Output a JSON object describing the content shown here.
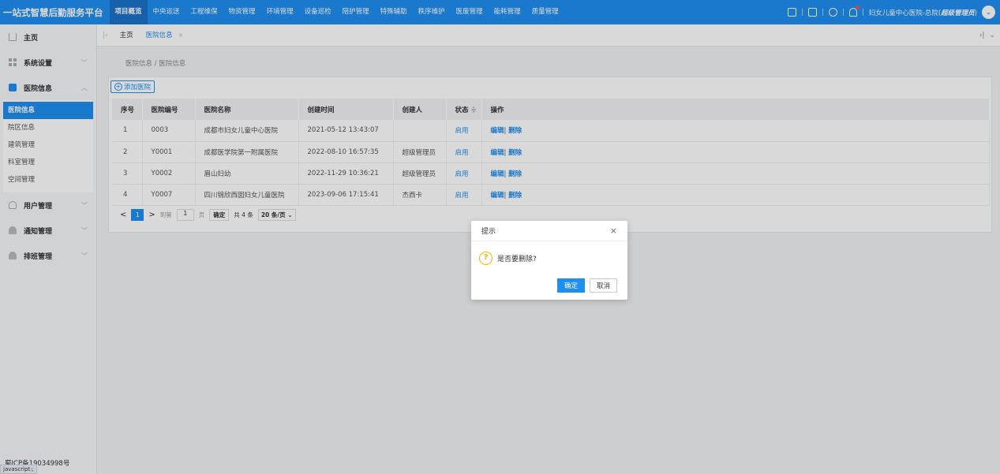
{
  "header": {
    "brand": "一站式智慧后勤服务平台",
    "nav": [
      "项目概览",
      "中央运送",
      "工程维保",
      "物资管理",
      "环境管理",
      "设备巡检",
      "陪护管理",
      "特殊辅助",
      "秩序维护",
      "医废管理",
      "能耗管理",
      "质量管理"
    ],
    "user_prefix": "妇女儿童中心医院-总院(",
    "user_role": "超级管理员",
    "user_suffix": ")",
    "separator": "|"
  },
  "sidebar": {
    "home": "主页",
    "system": "系统设置",
    "hospital": "医院信息",
    "hospital_sub": [
      "医院信息",
      "院区信息",
      "建筑管理",
      "科室管理",
      "空间管理"
    ],
    "user": "用户管理",
    "notice": "通知管理",
    "schedule": "排班管理",
    "icp": "蜀ICP备19034998号",
    "status_tip": "javascript:;"
  },
  "tabs": {
    "home": "主页",
    "current": "医院信息",
    "close": "×"
  },
  "breadcrumb": "医院信息 / 医院信息",
  "toolbar": {
    "add_label": "添加医院"
  },
  "table": {
    "headers": [
      "序号",
      "医院编号",
      "医院名称",
      "创建时间",
      "创建人",
      "状态",
      "操作"
    ],
    "sort_icon": "≑",
    "rows": [
      {
        "no": "1",
        "code": "0003",
        "name": "成都市妇女儿童中心医院",
        "time": "2021-05-12 13:43:07",
        "creator": "",
        "status": "启用"
      },
      {
        "no": "2",
        "code": "Y0001",
        "name": "成都医学院第一附属医院",
        "time": "2022-08-10 16:57:35",
        "creator": "超级管理员",
        "status": "启用"
      },
      {
        "no": "3",
        "code": "Y0002",
        "name": "眉山妇幼",
        "time": "2022-11-29 10:36:21",
        "creator": "超级管理员",
        "status": "启用"
      },
      {
        "no": "4",
        "code": "Y0007",
        "name": "四川锦欣西囡妇女儿童医院",
        "time": "2023-09-06 17:15:41",
        "creator": "杰西卡",
        "status": "启用"
      }
    ],
    "edit_label": "编辑",
    "op_sep": "|",
    "delete_label": "删除"
  },
  "pager": {
    "prev": "<",
    "current": "1",
    "next": ">",
    "goto_prefix": "到第",
    "goto_value": "1",
    "goto_suffix": "页",
    "confirm": "确定",
    "total": "共 4 条",
    "page_size": "20 条/页"
  },
  "dialog": {
    "title": "提示",
    "close": "×",
    "message": "是否要删除?",
    "ok": "确定",
    "cancel": "取消"
  },
  "colors": {
    "primary": "#1f8ef1",
    "warning": "#f4b400"
  }
}
